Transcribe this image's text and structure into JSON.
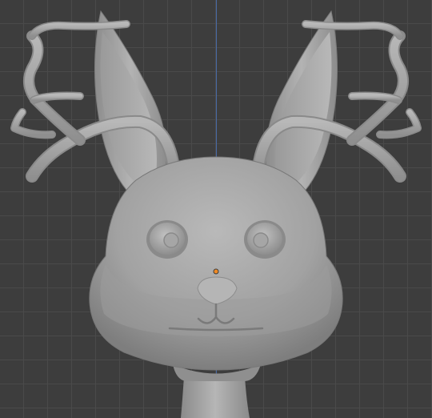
{
  "viewport": {
    "background_color": "#3d3d3d",
    "grid_color": "#4a4a4a",
    "axis_color": "#4a6fb0",
    "origin_color": "#f08a24"
  },
  "model": {
    "material_color": "#a4a4a4",
    "shadow_color": "#7b7b7b",
    "highlight_color": "#c9c9c9"
  }
}
